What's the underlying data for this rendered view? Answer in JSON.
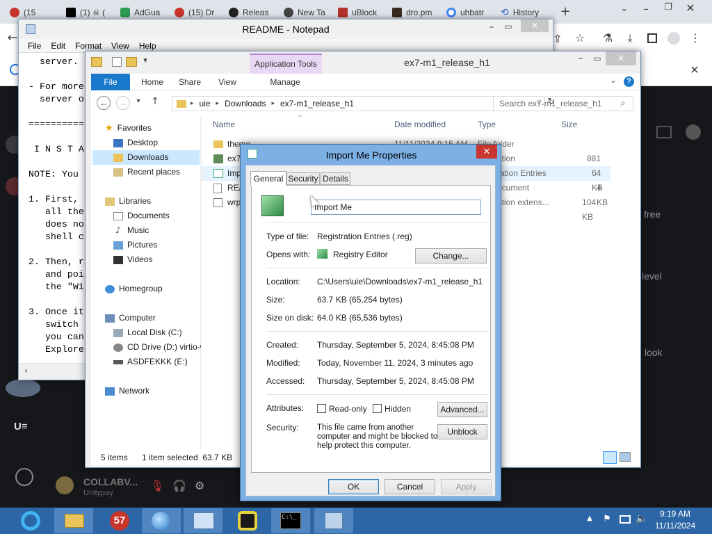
{
  "browser": {
    "tabs": [
      {
        "label": "(15",
        "badge": "15",
        "fav_color": "#c8352b"
      },
      {
        "label": "(1) ☠ (",
        "fav_color": "#000000"
      },
      {
        "label": "AdGua",
        "fav_color": "#2c9b51"
      },
      {
        "label": "(15) Dr",
        "badge": "15",
        "fav_color": "#c8352b"
      },
      {
        "label": "Releas",
        "fav_color": "#222222"
      },
      {
        "label": "New Ta",
        "fav_color": "#444444"
      },
      {
        "label": "uBlock",
        "fav_color": "#b0322b"
      },
      {
        "label": "dro.pm",
        "fav_color": "#3a2a20"
      },
      {
        "label": "uhbatr",
        "fav_color": "#4285f4"
      },
      {
        "label": "History",
        "fav_color": "#3367d6"
      }
    ],
    "new_tab": "+",
    "dark_page_text": [
      "free",
      "level",
      "look",
      "COLLABV...",
      "Unitypay"
    ]
  },
  "notepad": {
    "title": "README - Notepad",
    "menu": [
      "File",
      "Edit",
      "Format",
      "View",
      "Help"
    ],
    "lines": [
      "  server.",
      "",
      "- For more",
      "  server o",
      "",
      "==========",
      "",
      " I N S T A",
      "",
      "NOTE: You",
      "",
      "1. First,",
      "   all the",
      "   does no",
      "   shell c",
      "",
      "2. Then, r",
      "   and poi",
      "   the \"Wi",
      "",
      "3. Once it",
      "   switch",
      "   you can",
      "   Explore"
    ]
  },
  "explorer": {
    "title": "ex7-m1_release_h1",
    "context_tab": "Application Tools",
    "ribbon": [
      "File",
      "Home",
      "Share",
      "View",
      "Manage"
    ],
    "breadcrumbs": [
      "uie",
      "Downloads",
      "ex7-m1_release_h1"
    ],
    "search_placeholder": "Search ex7-m1_release_h1",
    "nav": {
      "favorites": "Favorites",
      "items": [
        "Desktop",
        "Downloads",
        "Recent places"
      ],
      "libraries": "Libraries",
      "lib_items": [
        "Documents",
        "Music",
        "Pictures",
        "Videos"
      ],
      "homegroup": "Homegroup",
      "computer": "Computer",
      "drives": [
        "Local Disk (C:)",
        "CD Drive (D:) virtio-w",
        "ASDFEKKK (E:)"
      ],
      "network": "Network"
    },
    "columns": {
      "name": "Name",
      "date": "Date modified",
      "type": "Type",
      "size": "Size"
    },
    "files": [
      {
        "name": "theme",
        "date": "11/11/2024 9:15 AM",
        "type": "File folder",
        "size": ""
      },
      {
        "name": "ex7",
        "date": "",
        "type": "ation",
        "size": "881 KB"
      },
      {
        "name": "Imp",
        "date": "",
        "type": "ration Entries",
        "size": "64 KB"
      },
      {
        "name": "REA",
        "date": "",
        "type": "ocument",
        "size": "4 KB"
      },
      {
        "name": "wrp",
        "date": "",
        "type": "ation extens...",
        "size": "104 KB"
      }
    ],
    "status_items": "5 items",
    "status_selected": "1 item selected  63.7 KB"
  },
  "dialog": {
    "title": "Import Me Properties",
    "tabs": [
      "General",
      "Security",
      "Details"
    ],
    "filename": "Import Me",
    "type_label": "Type of file:",
    "type_value": "Registration Entries (.reg)",
    "opens_label": "Opens with:",
    "opens_value": "Registry Editor",
    "change_button": "Change...",
    "location_label": "Location:",
    "location_value": "C:\\Users\\uie\\Downloads\\ex7-m1_release_h1",
    "size_label": "Size:",
    "size_value": "63.7 KB (65,254 bytes)",
    "size_on_disk_label": "Size on disk:",
    "size_on_disk_value": "64.0 KB (65,536 bytes)",
    "created_label": "Created:",
    "created_value": "Thursday, September 5, 2024, 8:45:08 PM",
    "modified_label": "Modified:",
    "modified_value": "Today, November 11, 2024, 3 minutes ago",
    "accessed_label": "Accessed:",
    "accessed_value": "Thursday, September 5, 2024, 8:45:08 PM",
    "attributes_label": "Attributes:",
    "readonly_label": "Read-only",
    "hidden_label": "Hidden",
    "advanced_button": "Advanced...",
    "security_label": "Security:",
    "security_text_1": "This file came from another",
    "security_text_2": "computer and might be blocked to",
    "security_text_3": "help protect this computer.",
    "unblock_button": "Unblock",
    "ok": "OK",
    "cancel": "Cancel",
    "apply": "Apply"
  },
  "taskbar": {
    "badge": "57",
    "time": "9:19 AM",
    "date": "11/11/2024"
  }
}
